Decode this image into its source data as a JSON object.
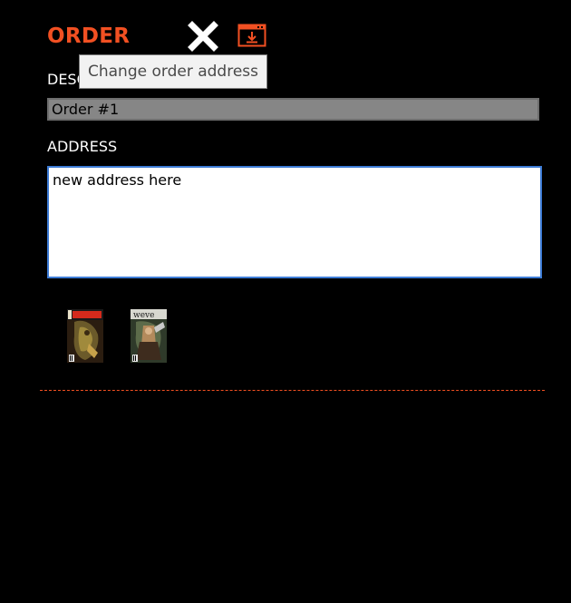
{
  "order": {
    "title": "ORDER",
    "accent_color": "#f25022",
    "close_icon": "close-icon",
    "save_icon": "save-download-icon"
  },
  "tooltip": {
    "text": "Change order address"
  },
  "description": {
    "label": "DESC",
    "value": "Order #1"
  },
  "address": {
    "label": "ADDRESS",
    "value": "new address here"
  },
  "comics": [
    {
      "title": "RAT GOD",
      "icon": "comic-cover-thumbnail"
    },
    {
      "title": "Weaver",
      "icon": "comic-cover-thumbnail"
    }
  ]
}
